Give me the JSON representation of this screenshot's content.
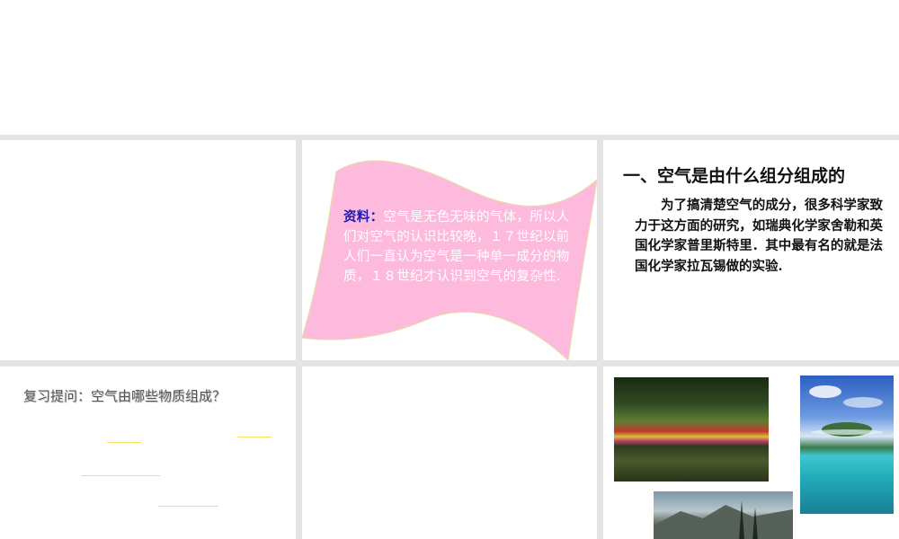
{
  "slides": {
    "slide2": {
      "label": "资料：",
      "text": "空气是无色无味的气体，所以人们对空气的认识比较晚，１７世纪以前人们一直认为空气是一种单一成分的物质，１８世纪才认识到空气的复杂性."
    },
    "slide3": {
      "title": "一、空气是由什么组分组成的",
      "body": "为了搞清楚空气的成分，很多科学家致力于这方面的研究，如瑞典化学家舍勒和英国化学家普里斯特里．其中最有名的就是法国化学家拉瓦锡做的实验."
    },
    "slide4": {
      "question": "复习提问：空气由哪些物质组成？"
    },
    "colors": {
      "flag_fill": "#fdbadd",
      "flag_label": "#1a1ab0",
      "blank_line": "#f5e25a",
      "grid": "#e4e4e4"
    }
  }
}
